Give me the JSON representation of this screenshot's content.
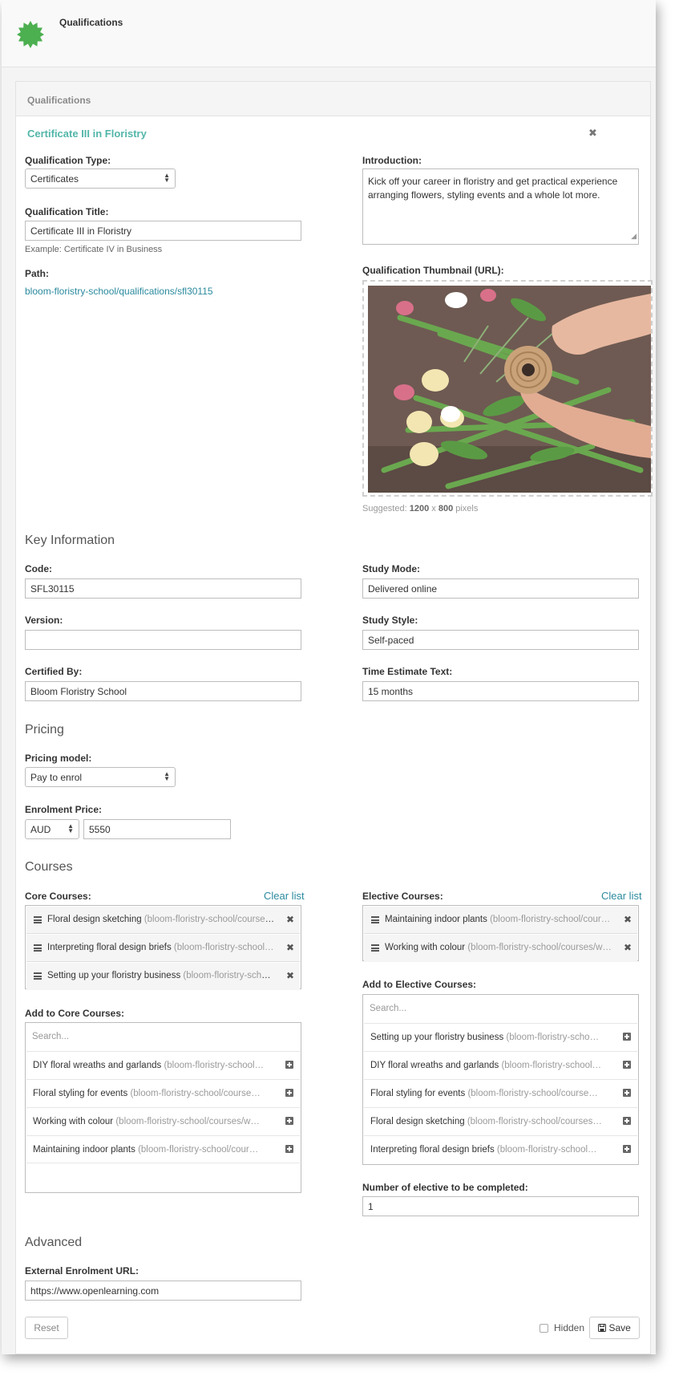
{
  "app": {
    "title": "Qualifications",
    "panel_title": "Qualifications"
  },
  "qualification": {
    "name": "Certificate III in Floristry",
    "close_icon": "close-icon",
    "type_label": "Qualification Type:",
    "type_value": "Certificates",
    "title_label": "Qualification Title:",
    "title_value": "Certificate III in Floristry",
    "title_hint": "Example: Certificate IV in Business",
    "path_label": "Path:",
    "path_value": "bloom-floristry-school/qualifications/sfl30115",
    "intro_label": "Introduction:",
    "intro_value": "Kick off your career in floristry and get practical experience arranging flowers, styling events and a whole lot more.",
    "thumb_label": "Qualification Thumbnail (URL):",
    "thumb_hint_prefix": "Suggested:",
    "thumb_hint_w": "1200",
    "thumb_hint_x": "x",
    "thumb_hint_h": "800",
    "thumb_hint_suffix": "pixels"
  },
  "key_info": {
    "heading": "Key Information",
    "code_label": "Code:",
    "code_value": "SFL30115",
    "version_label": "Version:",
    "version_value": "",
    "certified_label": "Certified By:",
    "certified_value": "Bloom Floristry School",
    "study_mode_label": "Study Mode:",
    "study_mode_value": "Delivered online",
    "study_style_label": "Study Style:",
    "study_style_value": "Self-paced",
    "time_label": "Time Estimate Text:",
    "time_value": "15 months"
  },
  "pricing": {
    "heading": "Pricing",
    "model_label": "Pricing model:",
    "model_value": "Pay to enrol",
    "price_label": "Enrolment Price:",
    "currency": "AUD",
    "price": "5550"
  },
  "courses": {
    "heading": "Courses",
    "clear_label": "Clear list",
    "core_label": "Core Courses:",
    "core_selected": [
      {
        "name": "Floral design sketching",
        "slug": "(bloom-floristry-school/courses…"
      },
      {
        "name": "Interpreting floral design briefs",
        "slug": "(bloom-floristry-school…"
      },
      {
        "name": "Setting up your floristry business",
        "slug": "(bloom-floristry-scho…"
      }
    ],
    "add_core_label": "Add to Core Courses:",
    "search_placeholder": "Search...",
    "core_available": [
      {
        "name": "DIY floral wreaths and garlands",
        "slug": "(bloom-floristry-school…"
      },
      {
        "name": "Floral styling for events",
        "slug": "(bloom-floristry-school/course…"
      },
      {
        "name": "Working with colour",
        "slug": "(bloom-floristry-school/courses/w…"
      },
      {
        "name": "Maintaining indoor plants",
        "slug": "(bloom-floristry-school/cour…"
      }
    ],
    "elective_label": "Elective Courses:",
    "elective_selected": [
      {
        "name": "Maintaining indoor plants",
        "slug": "(bloom-floristry-school/cour…"
      },
      {
        "name": "Working with colour",
        "slug": "(bloom-floristry-school/courses/w…"
      }
    ],
    "add_elective_label": "Add to Elective Courses:",
    "elective_available": [
      {
        "name": "Setting up your floristry business",
        "slug": "(bloom-floristry-scho…"
      },
      {
        "name": "DIY floral wreaths and garlands",
        "slug": "(bloom-floristry-school…"
      },
      {
        "name": "Floral styling for events",
        "slug": "(bloom-floristry-school/course…"
      },
      {
        "name": "Floral design sketching",
        "slug": "(bloom-floristry-school/courses…"
      },
      {
        "name": "Interpreting floral design briefs",
        "slug": "(bloom-floristry-school…"
      }
    ],
    "num_elective_label": "Number of elective to be completed:",
    "num_elective_value": "1"
  },
  "advanced": {
    "heading": "Advanced",
    "url_label": "External Enrolment URL:",
    "url_value": "https://www.openlearning.com"
  },
  "footer": {
    "reset_label": "Reset",
    "hidden_label": "Hidden",
    "save_label": "Save"
  },
  "colors": {
    "accent": "#52b6a9",
    "link": "#2b8a9e",
    "logo": "#4caf50"
  }
}
